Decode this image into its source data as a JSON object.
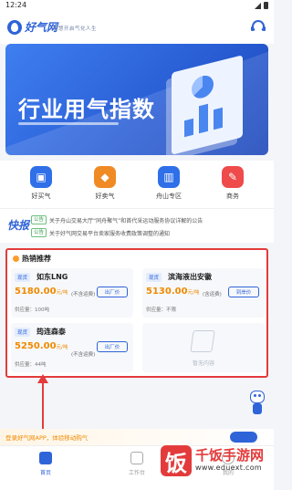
{
  "status_bar": {
    "time": "12:24"
  },
  "header": {
    "logo_text": "好气网",
    "slogan": "智慧开启气化人生"
  },
  "banner": {
    "title": "行业用气指数"
  },
  "quick_nav": [
    {
      "label": "好买气",
      "icon": "cart-icon",
      "color": "#2f6fe8"
    },
    {
      "label": "好卖气",
      "icon": "tag-icon",
      "color": "#f08a24"
    },
    {
      "label": "舟山专区",
      "icon": "building-icon",
      "color": "#2f6fe8"
    },
    {
      "label": "商务",
      "icon": "document-icon",
      "color": "#ef4b4b"
    }
  ],
  "news": {
    "badge": "快报",
    "items": [
      {
        "tag": "公告",
        "text": "关于舟山交易大厅“同舟聚气”和首代采运动服务协议详解的公告"
      },
      {
        "tag": "公告",
        "text": "关于好气网交易平台卖家服务收费政策调整的通知"
      }
    ]
  },
  "hot": {
    "title": "热销推荐",
    "cards": [
      {
        "tag": "现货",
        "name": "如东LNG",
        "price": "5180.00",
        "unit": "元/吨",
        "note": "(不含运费)",
        "button": "出厂价",
        "supply": "供应量：100吨"
      },
      {
        "tag": "现货",
        "name": "滨海液出安徽",
        "price": "5130.00",
        "unit": "元/吨",
        "note": "(含运费)",
        "button": "到岸价",
        "supply": "供应量：不限"
      },
      {
        "tag": "现货",
        "name": "筠连森泰",
        "price": "5250.00",
        "unit": "元/吨",
        "note": "(不含运费)",
        "button": "出厂价",
        "supply": "供应量：44吨"
      }
    ],
    "empty_text": "暂无内容"
  },
  "promo": {
    "text": "登录好气网APP，体验移动购气"
  },
  "bottom_nav": [
    {
      "label": "首页",
      "active": true
    },
    {
      "label": "工作台",
      "active": false
    },
    {
      "label": "我的",
      "active": false
    }
  ],
  "watermark": {
    "mark": "饭",
    "name": "千饭手游网",
    "url": "www.eduext.com"
  },
  "colors": {
    "brand": "#2f64d8",
    "price": "#f08a00",
    "highlight": "#e33b3b"
  }
}
